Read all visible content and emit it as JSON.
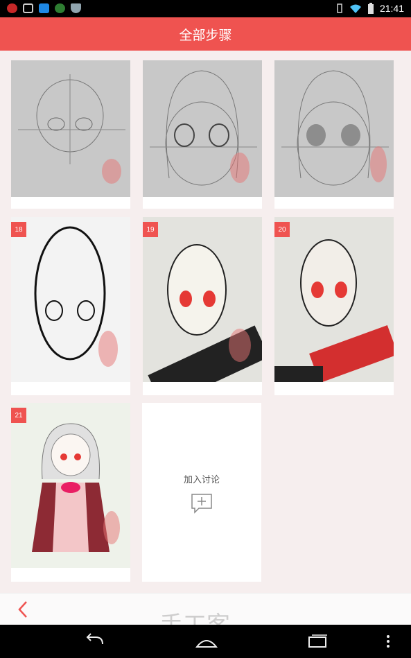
{
  "status_bar": {
    "time": "21:41",
    "icons": [
      "notification-red-icon",
      "image-icon",
      "app-icon",
      "badge-icon",
      "shield-icon",
      "vibrate-icon",
      "wifi-icon",
      "battery-icon"
    ]
  },
  "app_bar": {
    "title": "全部步骤"
  },
  "steps": [
    {
      "number": "",
      "style": "sketch"
    },
    {
      "number": "",
      "style": "sketch"
    },
    {
      "number": "",
      "style": "sketch"
    },
    {
      "number": "18",
      "style": "ink"
    },
    {
      "number": "19",
      "style": "photo"
    },
    {
      "number": "20",
      "style": "photo"
    },
    {
      "number": "21",
      "style": "art"
    }
  ],
  "discuss": {
    "label": "加入讨论",
    "icon": "add-comment-icon"
  },
  "bottom_bar": {
    "back_icon": "back-chevron-icon",
    "watermark": "手工客",
    "watermark_url": "shougongke.com"
  },
  "nav_bar": {
    "icons": [
      "back-icon",
      "home-icon",
      "recents-icon",
      "menu-icon"
    ]
  },
  "colors": {
    "accent": "#ef5350",
    "background": "#f6eeee"
  }
}
